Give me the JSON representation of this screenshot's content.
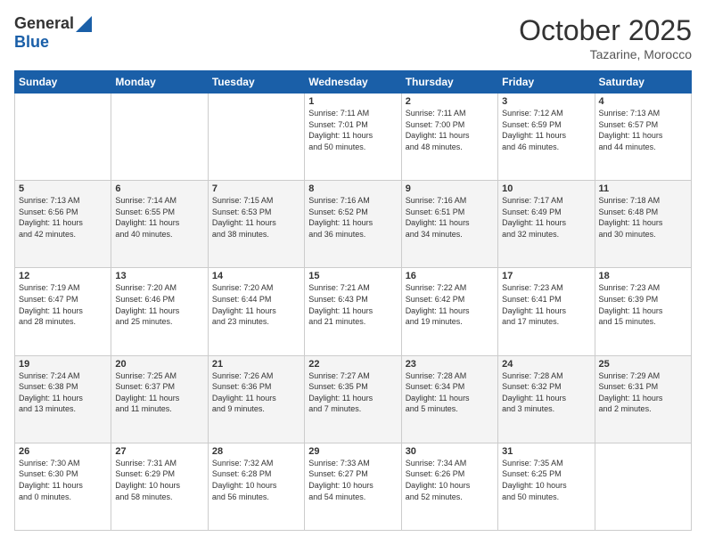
{
  "header": {
    "logo_general": "General",
    "logo_blue": "Blue",
    "month_title": "October 2025",
    "location": "Tazarine, Morocco"
  },
  "days_of_week": [
    "Sunday",
    "Monday",
    "Tuesday",
    "Wednesday",
    "Thursday",
    "Friday",
    "Saturday"
  ],
  "weeks": [
    [
      {
        "day": "",
        "info": ""
      },
      {
        "day": "",
        "info": ""
      },
      {
        "day": "",
        "info": ""
      },
      {
        "day": "1",
        "info": "Sunrise: 7:11 AM\nSunset: 7:01 PM\nDaylight: 11 hours\nand 50 minutes."
      },
      {
        "day": "2",
        "info": "Sunrise: 7:11 AM\nSunset: 7:00 PM\nDaylight: 11 hours\nand 48 minutes."
      },
      {
        "day": "3",
        "info": "Sunrise: 7:12 AM\nSunset: 6:59 PM\nDaylight: 11 hours\nand 46 minutes."
      },
      {
        "day": "4",
        "info": "Sunrise: 7:13 AM\nSunset: 6:57 PM\nDaylight: 11 hours\nand 44 minutes."
      }
    ],
    [
      {
        "day": "5",
        "info": "Sunrise: 7:13 AM\nSunset: 6:56 PM\nDaylight: 11 hours\nand 42 minutes."
      },
      {
        "day": "6",
        "info": "Sunrise: 7:14 AM\nSunset: 6:55 PM\nDaylight: 11 hours\nand 40 minutes."
      },
      {
        "day": "7",
        "info": "Sunrise: 7:15 AM\nSunset: 6:53 PM\nDaylight: 11 hours\nand 38 minutes."
      },
      {
        "day": "8",
        "info": "Sunrise: 7:16 AM\nSunset: 6:52 PM\nDaylight: 11 hours\nand 36 minutes."
      },
      {
        "day": "9",
        "info": "Sunrise: 7:16 AM\nSunset: 6:51 PM\nDaylight: 11 hours\nand 34 minutes."
      },
      {
        "day": "10",
        "info": "Sunrise: 7:17 AM\nSunset: 6:49 PM\nDaylight: 11 hours\nand 32 minutes."
      },
      {
        "day": "11",
        "info": "Sunrise: 7:18 AM\nSunset: 6:48 PM\nDaylight: 11 hours\nand 30 minutes."
      }
    ],
    [
      {
        "day": "12",
        "info": "Sunrise: 7:19 AM\nSunset: 6:47 PM\nDaylight: 11 hours\nand 28 minutes."
      },
      {
        "day": "13",
        "info": "Sunrise: 7:20 AM\nSunset: 6:46 PM\nDaylight: 11 hours\nand 25 minutes."
      },
      {
        "day": "14",
        "info": "Sunrise: 7:20 AM\nSunset: 6:44 PM\nDaylight: 11 hours\nand 23 minutes."
      },
      {
        "day": "15",
        "info": "Sunrise: 7:21 AM\nSunset: 6:43 PM\nDaylight: 11 hours\nand 21 minutes."
      },
      {
        "day": "16",
        "info": "Sunrise: 7:22 AM\nSunset: 6:42 PM\nDaylight: 11 hours\nand 19 minutes."
      },
      {
        "day": "17",
        "info": "Sunrise: 7:23 AM\nSunset: 6:41 PM\nDaylight: 11 hours\nand 17 minutes."
      },
      {
        "day": "18",
        "info": "Sunrise: 7:23 AM\nSunset: 6:39 PM\nDaylight: 11 hours\nand 15 minutes."
      }
    ],
    [
      {
        "day": "19",
        "info": "Sunrise: 7:24 AM\nSunset: 6:38 PM\nDaylight: 11 hours\nand 13 minutes."
      },
      {
        "day": "20",
        "info": "Sunrise: 7:25 AM\nSunset: 6:37 PM\nDaylight: 11 hours\nand 11 minutes."
      },
      {
        "day": "21",
        "info": "Sunrise: 7:26 AM\nSunset: 6:36 PM\nDaylight: 11 hours\nand 9 minutes."
      },
      {
        "day": "22",
        "info": "Sunrise: 7:27 AM\nSunset: 6:35 PM\nDaylight: 11 hours\nand 7 minutes."
      },
      {
        "day": "23",
        "info": "Sunrise: 7:28 AM\nSunset: 6:34 PM\nDaylight: 11 hours\nand 5 minutes."
      },
      {
        "day": "24",
        "info": "Sunrise: 7:28 AM\nSunset: 6:32 PM\nDaylight: 11 hours\nand 3 minutes."
      },
      {
        "day": "25",
        "info": "Sunrise: 7:29 AM\nSunset: 6:31 PM\nDaylight: 11 hours\nand 2 minutes."
      }
    ],
    [
      {
        "day": "26",
        "info": "Sunrise: 7:30 AM\nSunset: 6:30 PM\nDaylight: 11 hours\nand 0 minutes."
      },
      {
        "day": "27",
        "info": "Sunrise: 7:31 AM\nSunset: 6:29 PM\nDaylight: 10 hours\nand 58 minutes."
      },
      {
        "day": "28",
        "info": "Sunrise: 7:32 AM\nSunset: 6:28 PM\nDaylight: 10 hours\nand 56 minutes."
      },
      {
        "day": "29",
        "info": "Sunrise: 7:33 AM\nSunset: 6:27 PM\nDaylight: 10 hours\nand 54 minutes."
      },
      {
        "day": "30",
        "info": "Sunrise: 7:34 AM\nSunset: 6:26 PM\nDaylight: 10 hours\nand 52 minutes."
      },
      {
        "day": "31",
        "info": "Sunrise: 7:35 AM\nSunset: 6:25 PM\nDaylight: 10 hours\nand 50 minutes."
      },
      {
        "day": "",
        "info": ""
      }
    ]
  ]
}
